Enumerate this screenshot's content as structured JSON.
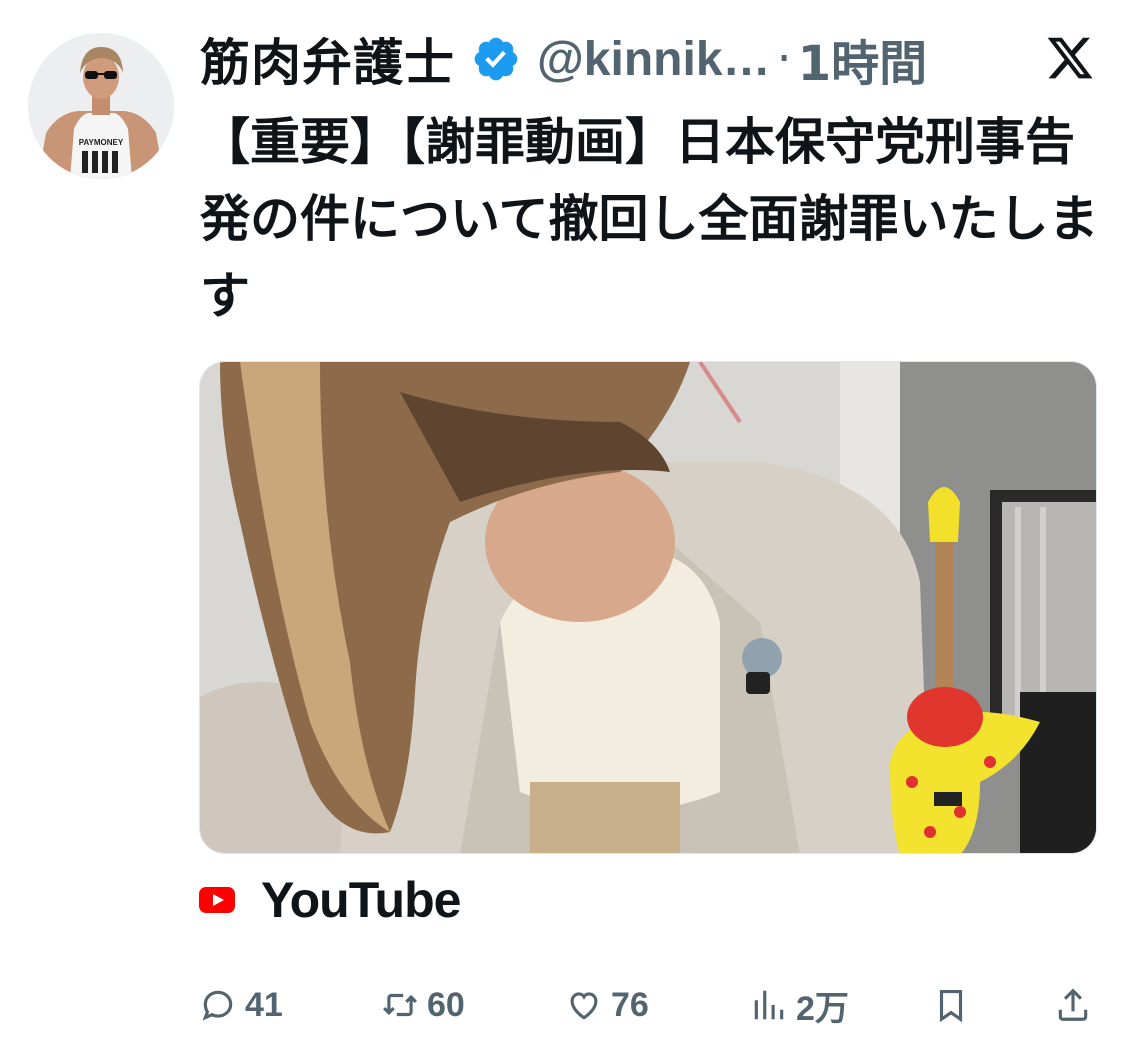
{
  "tweet": {
    "display_name": "筋肉弁護士",
    "handle": "@kinnik…",
    "separator": "·",
    "time": "1時間",
    "text": "【重要】【謝罪動画】日本保守党刑事告発の件について撤回し全面謝罪いたします"
  },
  "avatar": {
    "shirt_text": "PAYMONEY"
  },
  "card": {
    "source_label": "YouTube"
  },
  "actions": {
    "reply_count": "41",
    "retweet_count": "60",
    "like_count": "76",
    "view_count": "2万"
  },
  "colors": {
    "text": "#0f1419",
    "secondary": "#536471",
    "verified": "#1d9bf0",
    "youtube_red": "#ff0000"
  },
  "icons": {
    "verified": "verified-badge-icon",
    "x_logo": "x-logo-icon",
    "youtube": "youtube-icon",
    "reply": "reply-icon",
    "retweet": "retweet-icon",
    "like": "heart-icon",
    "views": "views-chart-icon",
    "bookmark": "bookmark-icon",
    "share": "share-icon"
  }
}
